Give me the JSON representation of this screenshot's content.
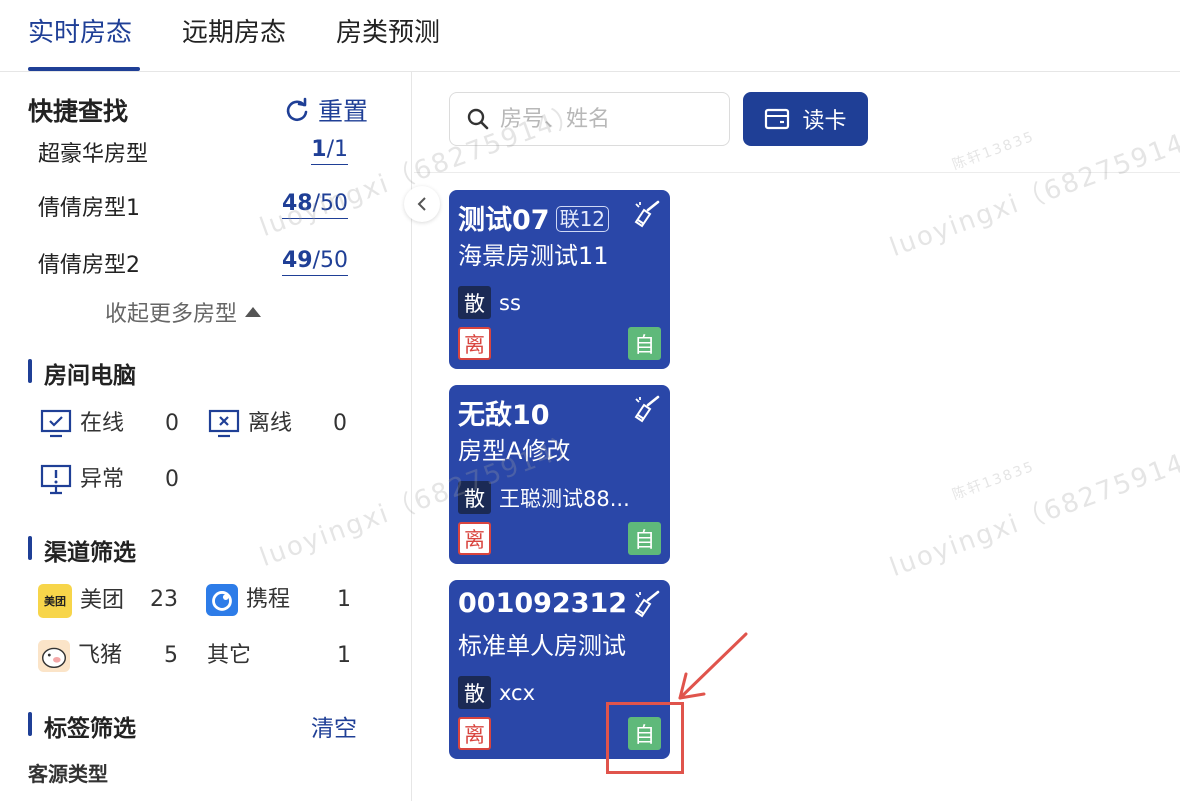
{
  "tabs": [
    {
      "label": "实时房态",
      "active": true
    },
    {
      "label": "远期房态",
      "active": false
    },
    {
      "label": "房类预测",
      "active": false
    }
  ],
  "sidebar": {
    "title": "快捷查找",
    "reset_label": "重置",
    "room_types": [
      {
        "name": "超豪华房型",
        "available": "1",
        "total": "/1"
      },
      {
        "name": "倩倩房型1",
        "available": "48",
        "total": "/50"
      },
      {
        "name": "倩倩房型2",
        "available": "49",
        "total": "/50"
      }
    ],
    "collapse_label": "收起更多房型",
    "room_pc": {
      "title": "房间电脑",
      "online_label": "在线",
      "online_count": "0",
      "offline_label": "离线",
      "offline_count": "0",
      "abnormal_label": "异常",
      "abnormal_count": "0"
    },
    "channels": {
      "title": "渠道筛选",
      "meituan_label": "美团",
      "meituan_count": "23",
      "ctrip_label": "携程",
      "ctrip_count": "1",
      "fliggy_label": "飞猪",
      "fliggy_count": "5",
      "other_label": "其它",
      "other_count": "1",
      "meituan_logo_text": "美团"
    },
    "tags": {
      "title": "标签筛选",
      "clear_label": "清空",
      "guest_source_label": "客源类型"
    }
  },
  "main": {
    "search_placeholder": "房号、姓名",
    "read_card_label": "读卡",
    "cards": [
      {
        "room": "测试07",
        "link_tag": "联12",
        "room_type": "海景房测试11",
        "guest_type": "散",
        "guest": "ss",
        "status_left": "离",
        "status_right": "自"
      },
      {
        "room": "无敌10",
        "link_tag": "",
        "room_type": "房型A修改",
        "guest_type": "散",
        "guest": "王聪测试88...",
        "status_left": "离",
        "status_right": "自"
      },
      {
        "room": "001092312",
        "link_tag": "",
        "room_type": "标准单人房测试",
        "guest_type": "散",
        "guest": "xcx",
        "status_left": "离",
        "status_right": "自"
      }
    ]
  },
  "watermark": {
    "text1": "luoyingxi（68275914）",
    "text2": "陈轩13835"
  },
  "colors": {
    "primary": "#1f3f96",
    "card_bg": "#2a47a8",
    "green": "#5fb97a",
    "red": "#d9453f"
  }
}
